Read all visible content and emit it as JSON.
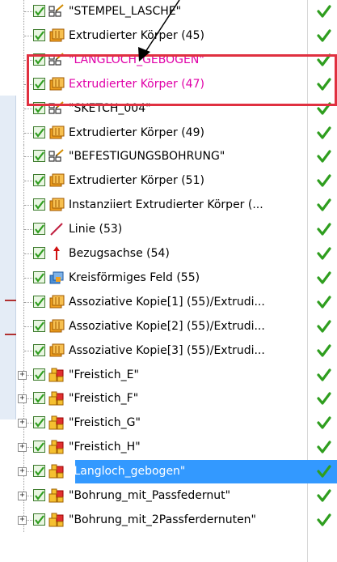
{
  "tree": {
    "rows": [
      {
        "label": "\"STEMPEL_LASCHE\"",
        "icon": "sketch-icon",
        "style": "normal",
        "status": "check",
        "expander": ""
      },
      {
        "label": "Extrudierter Körper (45)",
        "icon": "extrude-icon",
        "style": "normal",
        "status": "check",
        "expander": ""
      },
      {
        "label": "\"LANGLOCH_GEBOGEN\"",
        "icon": "sketch-icon",
        "style": "magenta",
        "status": "check",
        "expander": ""
      },
      {
        "label": "Extrudierter Körper (47)",
        "icon": "extrude-icon",
        "style": "magenta",
        "status": "check",
        "expander": ""
      },
      {
        "label": "\"SKETCH_004\"",
        "icon": "sketch-icon",
        "style": "normal",
        "status": "check",
        "expander": ""
      },
      {
        "label": "Extrudierter Körper (49)",
        "icon": "extrude-icon",
        "style": "normal",
        "status": "check",
        "expander": ""
      },
      {
        "label": "\"BEFESTIGUNGSBOHRUNG\"",
        "icon": "sketch-icon",
        "style": "normal",
        "status": "check",
        "expander": ""
      },
      {
        "label": "Extrudierter Körper (51)",
        "icon": "extrude-icon",
        "style": "normal",
        "status": "check",
        "expander": ""
      },
      {
        "label": "Instanziiert Extrudierter Körper (...",
        "icon": "extrude-icon",
        "style": "normal",
        "status": "check",
        "expander": ""
      },
      {
        "label": "Linie (53)",
        "icon": "line-icon",
        "style": "normal",
        "status": "check",
        "expander": ""
      },
      {
        "label": "Bezugsachse (54)",
        "icon": "datum-axis-icon",
        "style": "normal",
        "status": "check",
        "expander": ""
      },
      {
        "label": "Kreisförmiges Feld (55)",
        "icon": "pattern-icon",
        "style": "normal",
        "status": "check",
        "expander": ""
      },
      {
        "label": "Assoziative Kopie[1] (55)/Extrudi...",
        "icon": "extrude-icon",
        "style": "normal",
        "status": "check",
        "expander": ""
      },
      {
        "label": "Assoziative Kopie[2] (55)/Extrudi...",
        "icon": "extrude-icon",
        "style": "normal",
        "status": "check",
        "expander": ""
      },
      {
        "label": "Assoziative Kopie[3] (55)/Extrudi...",
        "icon": "extrude-icon",
        "style": "normal",
        "status": "check",
        "expander": ""
      },
      {
        "label": "\"Freistich_E\"",
        "icon": "udf-icon",
        "style": "normal",
        "status": "check",
        "expander": "+"
      },
      {
        "label": "\"Freistich_F\"",
        "icon": "udf-icon",
        "style": "normal",
        "status": "check",
        "expander": "+"
      },
      {
        "label": "\"Freistich_G\"",
        "icon": "udf-icon",
        "style": "normal",
        "status": "check",
        "expander": "+"
      },
      {
        "label": "\"Freistich_H\"",
        "icon": "udf-icon",
        "style": "normal",
        "status": "check",
        "expander": "+"
      },
      {
        "label": "\"Langloch_gebogen\"",
        "icon": "udf-icon",
        "style": "selected",
        "status": "check",
        "expander": "+"
      },
      {
        "label": "\"Bohrung_mit_Passfedernut\"",
        "icon": "udf-icon",
        "style": "normal",
        "status": "check",
        "expander": "+"
      },
      {
        "label": "\"Bohrung_mit_2Passferdernuten\"",
        "icon": "udf-icon",
        "style": "normal",
        "status": "check",
        "expander": "+"
      }
    ]
  },
  "colors": {
    "highlight_text": "#e000a8",
    "highlight_box": "#e03040",
    "selection": "#3399ff",
    "status_check": "#2f9e1f"
  }
}
